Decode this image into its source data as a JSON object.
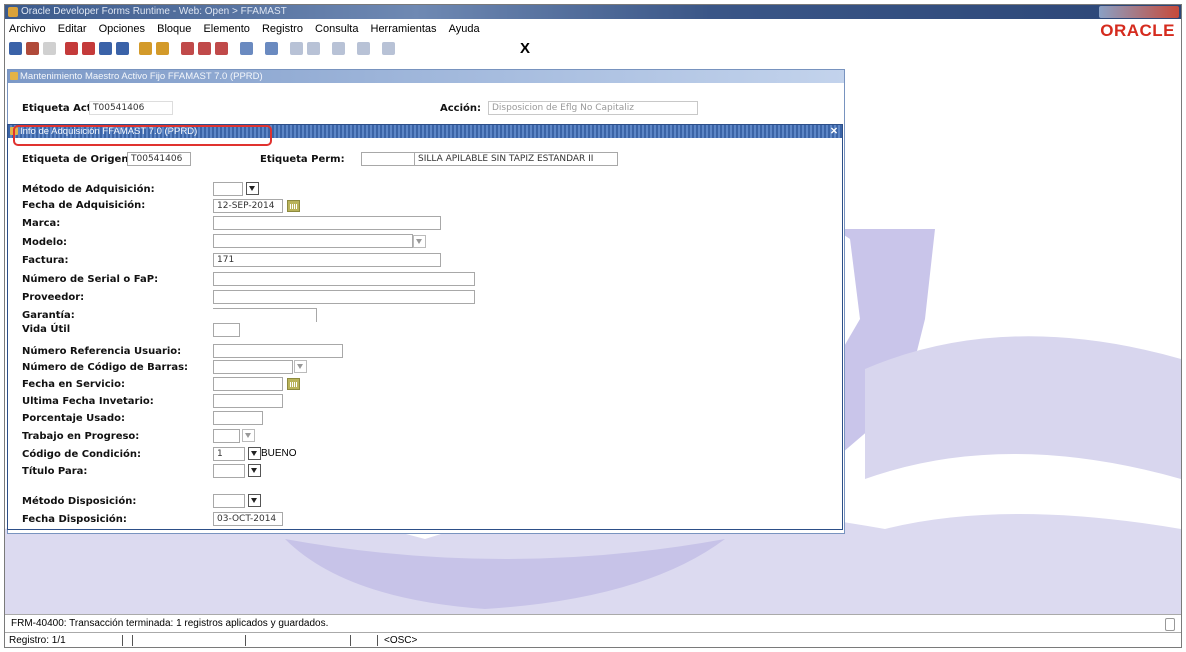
{
  "window": {
    "title": "Oracle Developer Forms Runtime - Web:  Open > FFAMAST"
  },
  "brand": {
    "logo_text": "ORACLE",
    "logo_color": "#d52b1e"
  },
  "menu": [
    "Archivo",
    "Editar",
    "Opciones",
    "Bloque",
    "Elemento",
    "Registro",
    "Consulta",
    "Herramientas",
    "Ayuda"
  ],
  "toolbar": {
    "exit_label": "X"
  },
  "main_form": {
    "title": "Mantenimiento Maestro Activo Fijo  FFAMAST  7.0  (PPRD)",
    "etiqueta_label": "Etiqueta Activ",
    "etiqueta_value": "T00541406",
    "accion_label": "Acción:",
    "accion_value": "Disposicion de Eflg No Capitaliz"
  },
  "acq_form": {
    "title": "Info de Adquisición  FFAMAST  7.0  (PPRD)",
    "origen_label": "Etiqueta de Origen",
    "origen_value": "T00541406",
    "perm_label": "Etiqueta Perm:",
    "perm_value": "",
    "desc_value": "SILLA APILABLE SIN TAPIZ ESTANDAR II",
    "fields": {
      "metodo_adq": {
        "label": "Método de Adquisición:",
        "value": ""
      },
      "fecha_adq": {
        "label": "Fecha de Adquisición:",
        "value": "12-SEP-2014"
      },
      "marca": {
        "label": "Marca:",
        "value": ""
      },
      "modelo": {
        "label": "Modelo:",
        "value": ""
      },
      "factura": {
        "label": "Factura:",
        "value": "171"
      },
      "serial": {
        "label": "Número de Serial o FaP:",
        "value": ""
      },
      "proveedor": {
        "label": "Proveedor:",
        "value": ""
      },
      "garantia": {
        "label": "Garantía:",
        "value": ""
      },
      "vida_util": {
        "label": "Vida Útil",
        "value": ""
      },
      "ref_usuario": {
        "label": "Número Referencia Usuario:",
        "value": ""
      },
      "cod_barras": {
        "label": "Número de Código de Barras:",
        "value": ""
      },
      "fecha_servicio": {
        "label": "Fecha en Servicio:",
        "value": ""
      },
      "ultima_fecha": {
        "label": "Ultima Fecha Invetario:",
        "value": ""
      },
      "porcentaje": {
        "label": "Porcentaje Usado:",
        "value": ""
      },
      "trabajo": {
        "label": "Trabajo en Progreso:",
        "value": ""
      },
      "condicion": {
        "label": "Código de Condición:",
        "value": "1",
        "desc": "BUENO"
      },
      "titulo": {
        "label": "Título Para:",
        "value": ""
      },
      "metodo_disp": {
        "label": "Método Disposición:",
        "value": ""
      },
      "fecha_disp": {
        "label": "Fecha Disposición:",
        "value": "03-OCT-2014"
      }
    }
  },
  "status": {
    "message": "FRM-40400: Transacción terminada: 1 registros aplicados y guardados.",
    "record": "Registro: 1/1",
    "osc": "<OSC>"
  },
  "colors": {
    "highlight": "#e0322f",
    "title_bar": "#3b5a8c",
    "watermark": "#d8d6ee"
  }
}
